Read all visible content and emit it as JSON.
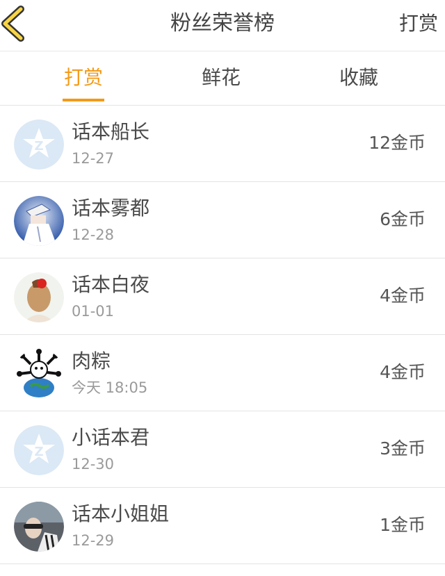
{
  "header": {
    "title": "粉丝荣誉榜",
    "right_action": "打赏"
  },
  "tabs": [
    {
      "label": "打赏",
      "active": true
    },
    {
      "label": "鲜花",
      "active": false
    },
    {
      "label": "收藏",
      "active": false
    }
  ],
  "colors": {
    "accent": "#f39a17",
    "back_icon_fill": "#f7d546",
    "placeholder_avatar": "#dbe8f5"
  },
  "fans": [
    {
      "name": "话本船长",
      "date": "12-27",
      "amount": "12金币",
      "avatar": "qq-placeholder-avatar"
    },
    {
      "name": "话本雾都",
      "date": "12-28",
      "amount": "6金币",
      "avatar": "anime-avatar"
    },
    {
      "name": "话本白夜",
      "date": "01-01",
      "amount": "4金币",
      "avatar": "photo-avatar"
    },
    {
      "name": "肉粽",
      "date": "今天 18:05",
      "amount": "4金币",
      "avatar": "cartoon-globe-avatar"
    },
    {
      "name": "小话本君",
      "date": "12-30",
      "amount": "3金币",
      "avatar": "qq-placeholder-avatar"
    },
    {
      "name": "话本小姐姐",
      "date": "12-29",
      "amount": "1金币",
      "avatar": "photo-avatar"
    }
  ]
}
